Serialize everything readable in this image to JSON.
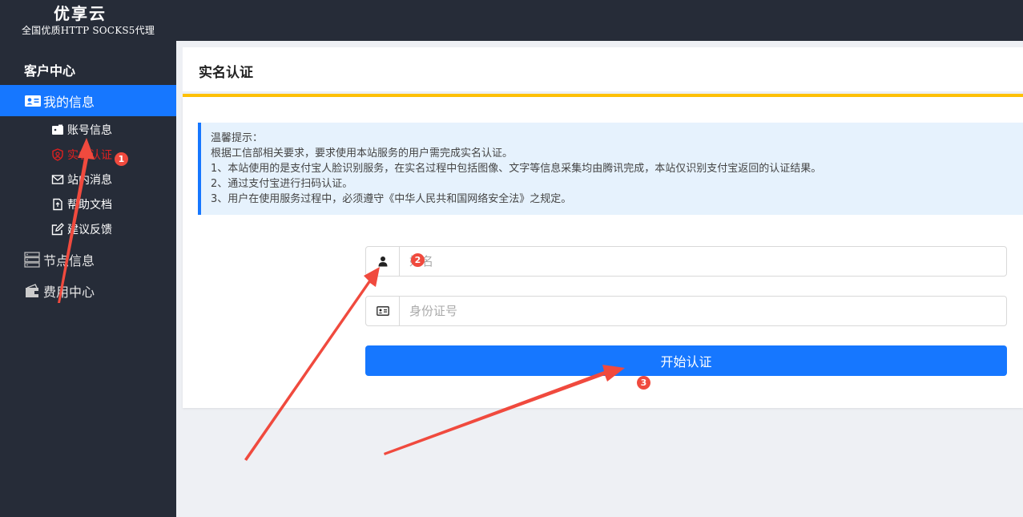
{
  "brand": {
    "title": "优享云",
    "subtitle": "全国优质HTTP SOCKS5代理"
  },
  "sidebar": {
    "heading": "客户中心",
    "main_item": "我的信息",
    "sub_items": [
      {
        "label": "账号信息",
        "icon": "wallet-icon"
      },
      {
        "label": "实名认证",
        "icon": "verify-shield-icon"
      },
      {
        "label": "站内消息",
        "icon": "envelope-icon"
      },
      {
        "label": "帮助文档",
        "icon": "document-icon"
      },
      {
        "label": "建议反馈",
        "icon": "edit-icon"
      }
    ],
    "groups": [
      {
        "label": "节点信息",
        "icon": "server-icon"
      },
      {
        "label": "费用中心",
        "icon": "purse-icon"
      }
    ]
  },
  "page": {
    "title": "实名认证"
  },
  "notice": {
    "lines": [
      "温馨提示：",
      "根据工信部相关要求，要求使用本站服务的用户需完成实名认证。",
      "1、本站使用的是支付宝人脸识别服务，在实名过程中包括图像、文字等信息采集均由腾讯完成，本站仅识别支付宝返回的认证结果。",
      "2、通过支付宝进行扫码认证。",
      "3、用户在使用服务过程中，必须遵守《中华人民共和国网络安全法》之规定。"
    ]
  },
  "form": {
    "name_placeholder": "姓名",
    "id_placeholder": "身份证号",
    "submit_label": "开始认证"
  },
  "annotations": {
    "badge1": "1",
    "badge2": "2",
    "badge3": "3"
  },
  "colors": {
    "primary": "#1677ff",
    "sidebar": "#262c38",
    "accent_yellow": "#ffc107",
    "annotation_red": "#f04a3e"
  }
}
